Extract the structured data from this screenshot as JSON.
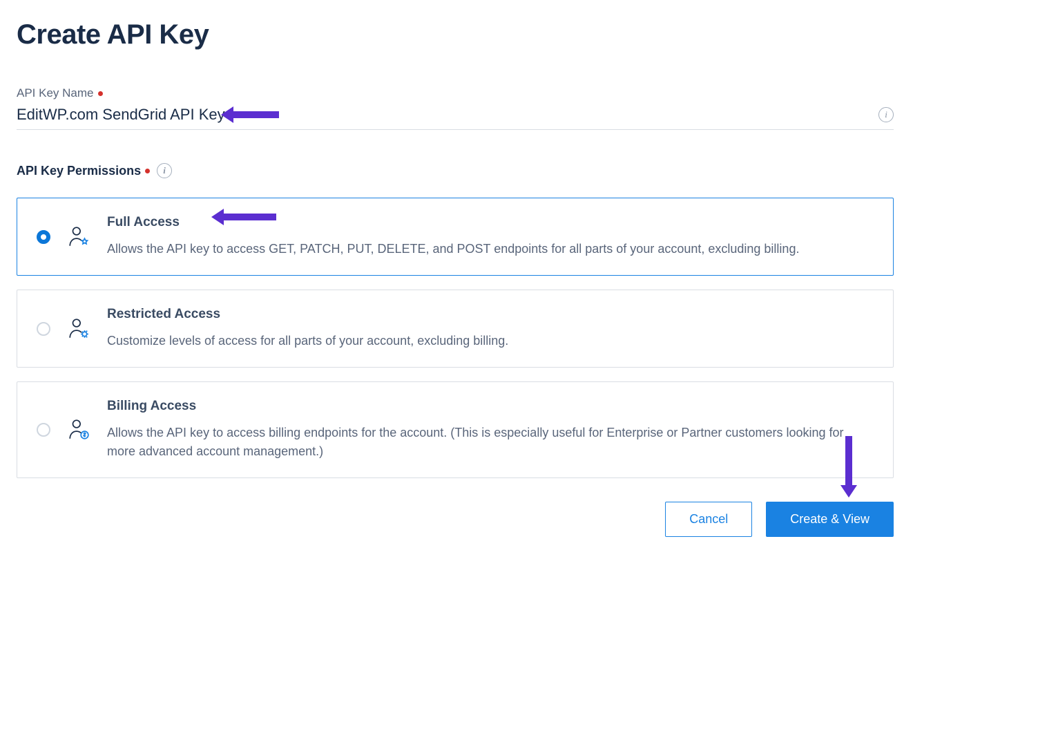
{
  "page": {
    "title": "Create API Key"
  },
  "apiKeyName": {
    "label": "API Key Name",
    "value": "EditWP.com SendGrid API Key"
  },
  "permissions": {
    "section_label": "API Key Permissions",
    "options": [
      {
        "id": "full",
        "title": "Full Access",
        "description": "Allows the API key to access GET, PATCH, PUT, DELETE, and POST endpoints for all parts of your account, excluding billing.",
        "selected": true
      },
      {
        "id": "restricted",
        "title": "Restricted Access",
        "description": "Customize levels of access for all parts of your account, excluding billing.",
        "selected": false
      },
      {
        "id": "billing",
        "title": "Billing Access",
        "description": "Allows the API key to access billing endpoints for the account. (This is especially useful for Enterprise or Partner customers looking for more advanced account management.)",
        "selected": false
      }
    ]
  },
  "buttons": {
    "cancel": "Cancel",
    "submit": "Create & View"
  },
  "colors": {
    "accent_blue": "#1a82e2",
    "annotation_purple": "#5b2ed0",
    "required_red": "#d4312c"
  }
}
